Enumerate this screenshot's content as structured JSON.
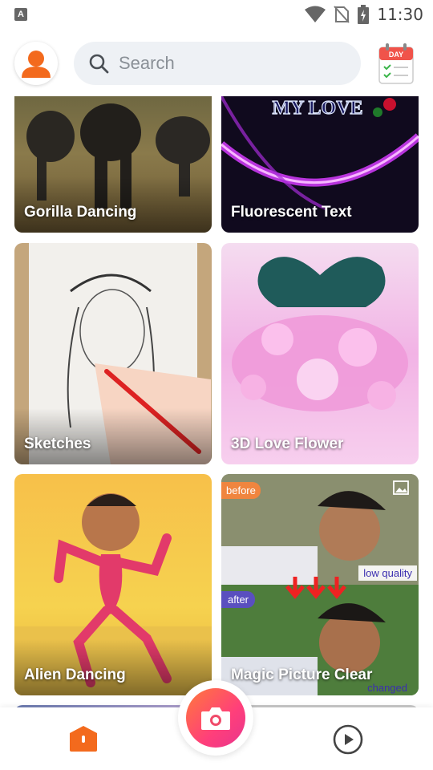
{
  "status_bar": {
    "time": "11:30",
    "notification_letter": "A"
  },
  "search": {
    "placeholder": "Search"
  },
  "calendar": {
    "label": "DAY"
  },
  "cards": [
    {
      "label": "Gorilla Dancing"
    },
    {
      "label": "Fluorescent Text",
      "overlay_text": "MY LOVE"
    },
    {
      "label": "Sketches"
    },
    {
      "label": "3D Love Flower"
    },
    {
      "label": "Alien Dancing"
    },
    {
      "label": "Magic Picture Clear",
      "before": "before",
      "after": "after",
      "low_quality": "low quality",
      "changed": "changed"
    }
  ],
  "colors": {
    "accent": "#f36a1d",
    "camera_gradient_start": "#ff7a3a",
    "camera_gradient_end": "#e8358e"
  }
}
